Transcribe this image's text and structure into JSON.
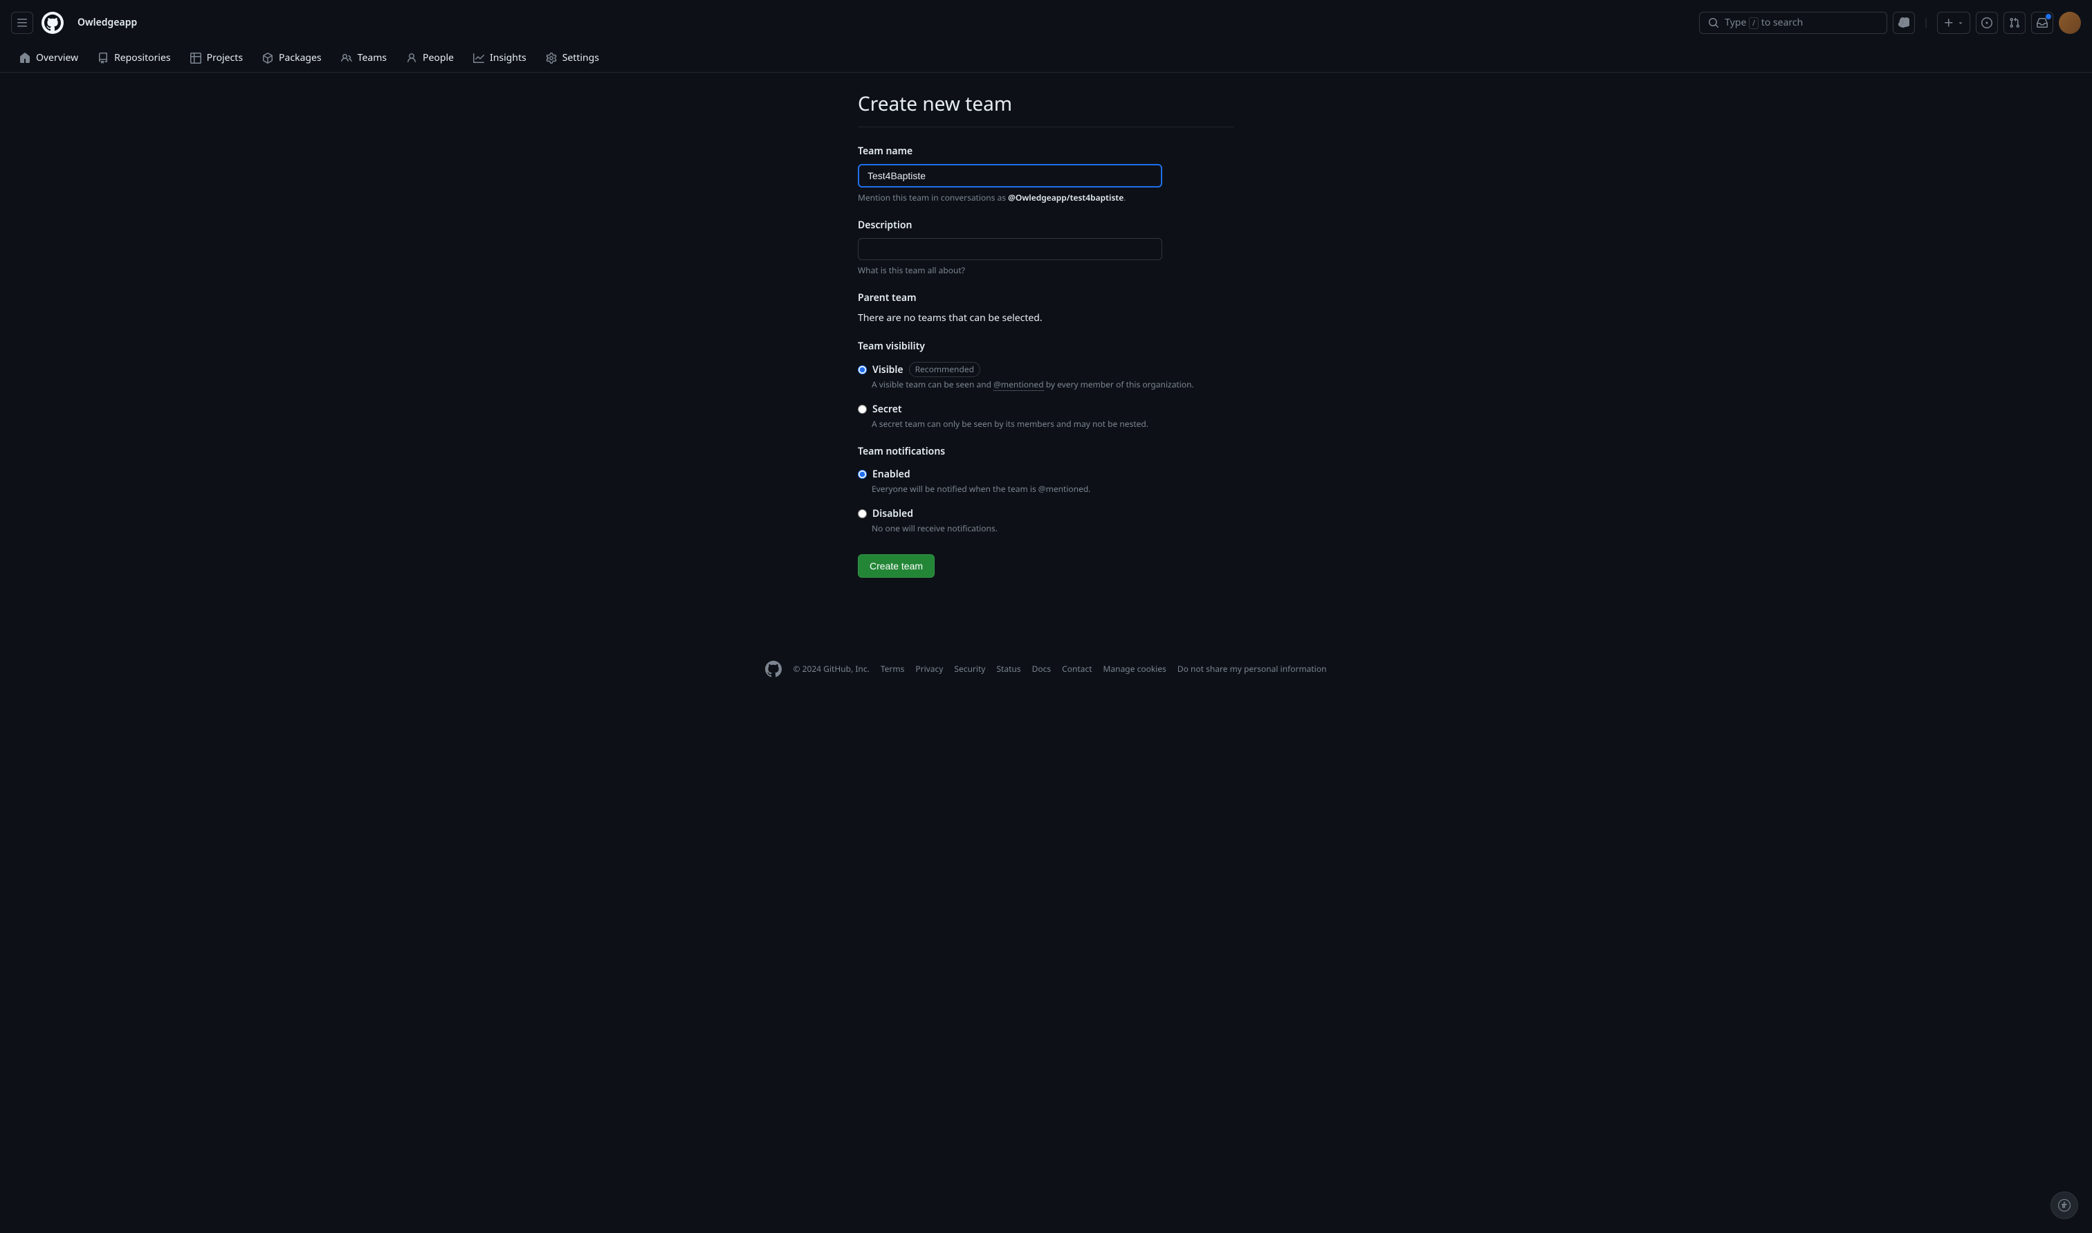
{
  "header": {
    "org_name": "Owledgeapp",
    "search_prefix": "Type ",
    "search_suffix": " to search",
    "slash": "/"
  },
  "nav": {
    "overview": "Overview",
    "repositories": "Repositories",
    "projects": "Projects",
    "packages": "Packages",
    "teams": "Teams",
    "people": "People",
    "insights": "Insights",
    "settings": "Settings"
  },
  "page": {
    "title": "Create new team",
    "team_name_label": "Team name",
    "team_name_value": "Test4Baptiste",
    "mention_prefix": "Mention this team in conversations as ",
    "mention_slug": "@Owledgeapp/test4baptiste",
    "mention_suffix": ".",
    "description_label": "Description",
    "description_help": "What is this team all about?",
    "parent_label": "Parent team",
    "parent_text": "There are no teams that can be selected.",
    "visibility_label": "Team visibility",
    "visible_label": "Visible",
    "recommended_badge": "Recommended",
    "visible_desc_prefix": "A visible team can be seen and ",
    "visible_desc_link": "@mentioned",
    "visible_desc_suffix": " by every member of this organization.",
    "secret_label": "Secret",
    "secret_desc": "A secret team can only be seen by its members and may not be nested.",
    "notifications_label": "Team notifications",
    "enabled_label": "Enabled",
    "enabled_desc": "Everyone will be notified when the team is @mentioned.",
    "disabled_label": "Disabled",
    "disabled_desc": "No one will receive notifications.",
    "submit_label": "Create team"
  },
  "footer": {
    "copyright": "© 2024 GitHub, Inc.",
    "terms": "Terms",
    "privacy": "Privacy",
    "security": "Security",
    "status": "Status",
    "docs": "Docs",
    "contact": "Contact",
    "cookies": "Manage cookies",
    "dns": "Do not share my personal information"
  }
}
